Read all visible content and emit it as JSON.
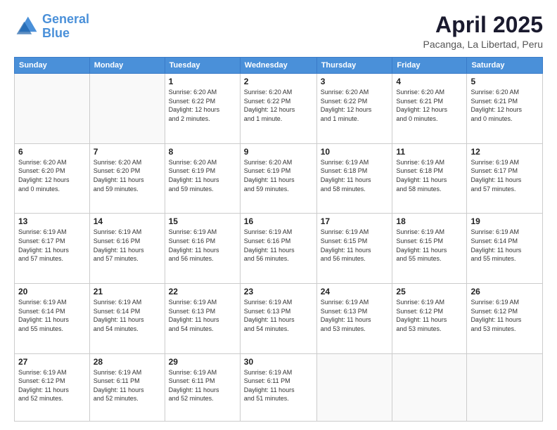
{
  "header": {
    "logo_line1": "General",
    "logo_line2": "Blue",
    "title": "April 2025",
    "subtitle": "Pacanga, La Libertad, Peru"
  },
  "calendar": {
    "days_of_week": [
      "Sunday",
      "Monday",
      "Tuesday",
      "Wednesday",
      "Thursday",
      "Friday",
      "Saturday"
    ],
    "weeks": [
      [
        {
          "day": "",
          "info": ""
        },
        {
          "day": "",
          "info": ""
        },
        {
          "day": "1",
          "info": "Sunrise: 6:20 AM\nSunset: 6:22 PM\nDaylight: 12 hours\nand 2 minutes."
        },
        {
          "day": "2",
          "info": "Sunrise: 6:20 AM\nSunset: 6:22 PM\nDaylight: 12 hours\nand 1 minute."
        },
        {
          "day": "3",
          "info": "Sunrise: 6:20 AM\nSunset: 6:22 PM\nDaylight: 12 hours\nand 1 minute."
        },
        {
          "day": "4",
          "info": "Sunrise: 6:20 AM\nSunset: 6:21 PM\nDaylight: 12 hours\nand 0 minutes."
        },
        {
          "day": "5",
          "info": "Sunrise: 6:20 AM\nSunset: 6:21 PM\nDaylight: 12 hours\nand 0 minutes."
        }
      ],
      [
        {
          "day": "6",
          "info": "Sunrise: 6:20 AM\nSunset: 6:20 PM\nDaylight: 12 hours\nand 0 minutes."
        },
        {
          "day": "7",
          "info": "Sunrise: 6:20 AM\nSunset: 6:20 PM\nDaylight: 11 hours\nand 59 minutes."
        },
        {
          "day": "8",
          "info": "Sunrise: 6:20 AM\nSunset: 6:19 PM\nDaylight: 11 hours\nand 59 minutes."
        },
        {
          "day": "9",
          "info": "Sunrise: 6:20 AM\nSunset: 6:19 PM\nDaylight: 11 hours\nand 59 minutes."
        },
        {
          "day": "10",
          "info": "Sunrise: 6:19 AM\nSunset: 6:18 PM\nDaylight: 11 hours\nand 58 minutes."
        },
        {
          "day": "11",
          "info": "Sunrise: 6:19 AM\nSunset: 6:18 PM\nDaylight: 11 hours\nand 58 minutes."
        },
        {
          "day": "12",
          "info": "Sunrise: 6:19 AM\nSunset: 6:17 PM\nDaylight: 11 hours\nand 57 minutes."
        }
      ],
      [
        {
          "day": "13",
          "info": "Sunrise: 6:19 AM\nSunset: 6:17 PM\nDaylight: 11 hours\nand 57 minutes."
        },
        {
          "day": "14",
          "info": "Sunrise: 6:19 AM\nSunset: 6:16 PM\nDaylight: 11 hours\nand 57 minutes."
        },
        {
          "day": "15",
          "info": "Sunrise: 6:19 AM\nSunset: 6:16 PM\nDaylight: 11 hours\nand 56 minutes."
        },
        {
          "day": "16",
          "info": "Sunrise: 6:19 AM\nSunset: 6:16 PM\nDaylight: 11 hours\nand 56 minutes."
        },
        {
          "day": "17",
          "info": "Sunrise: 6:19 AM\nSunset: 6:15 PM\nDaylight: 11 hours\nand 56 minutes."
        },
        {
          "day": "18",
          "info": "Sunrise: 6:19 AM\nSunset: 6:15 PM\nDaylight: 11 hours\nand 55 minutes."
        },
        {
          "day": "19",
          "info": "Sunrise: 6:19 AM\nSunset: 6:14 PM\nDaylight: 11 hours\nand 55 minutes."
        }
      ],
      [
        {
          "day": "20",
          "info": "Sunrise: 6:19 AM\nSunset: 6:14 PM\nDaylight: 11 hours\nand 55 minutes."
        },
        {
          "day": "21",
          "info": "Sunrise: 6:19 AM\nSunset: 6:14 PM\nDaylight: 11 hours\nand 54 minutes."
        },
        {
          "day": "22",
          "info": "Sunrise: 6:19 AM\nSunset: 6:13 PM\nDaylight: 11 hours\nand 54 minutes."
        },
        {
          "day": "23",
          "info": "Sunrise: 6:19 AM\nSunset: 6:13 PM\nDaylight: 11 hours\nand 54 minutes."
        },
        {
          "day": "24",
          "info": "Sunrise: 6:19 AM\nSunset: 6:13 PM\nDaylight: 11 hours\nand 53 minutes."
        },
        {
          "day": "25",
          "info": "Sunrise: 6:19 AM\nSunset: 6:12 PM\nDaylight: 11 hours\nand 53 minutes."
        },
        {
          "day": "26",
          "info": "Sunrise: 6:19 AM\nSunset: 6:12 PM\nDaylight: 11 hours\nand 53 minutes."
        }
      ],
      [
        {
          "day": "27",
          "info": "Sunrise: 6:19 AM\nSunset: 6:12 PM\nDaylight: 11 hours\nand 52 minutes."
        },
        {
          "day": "28",
          "info": "Sunrise: 6:19 AM\nSunset: 6:11 PM\nDaylight: 11 hours\nand 52 minutes."
        },
        {
          "day": "29",
          "info": "Sunrise: 6:19 AM\nSunset: 6:11 PM\nDaylight: 11 hours\nand 52 minutes."
        },
        {
          "day": "30",
          "info": "Sunrise: 6:19 AM\nSunset: 6:11 PM\nDaylight: 11 hours\nand 51 minutes."
        },
        {
          "day": "",
          "info": ""
        },
        {
          "day": "",
          "info": ""
        },
        {
          "day": "",
          "info": ""
        }
      ]
    ]
  }
}
